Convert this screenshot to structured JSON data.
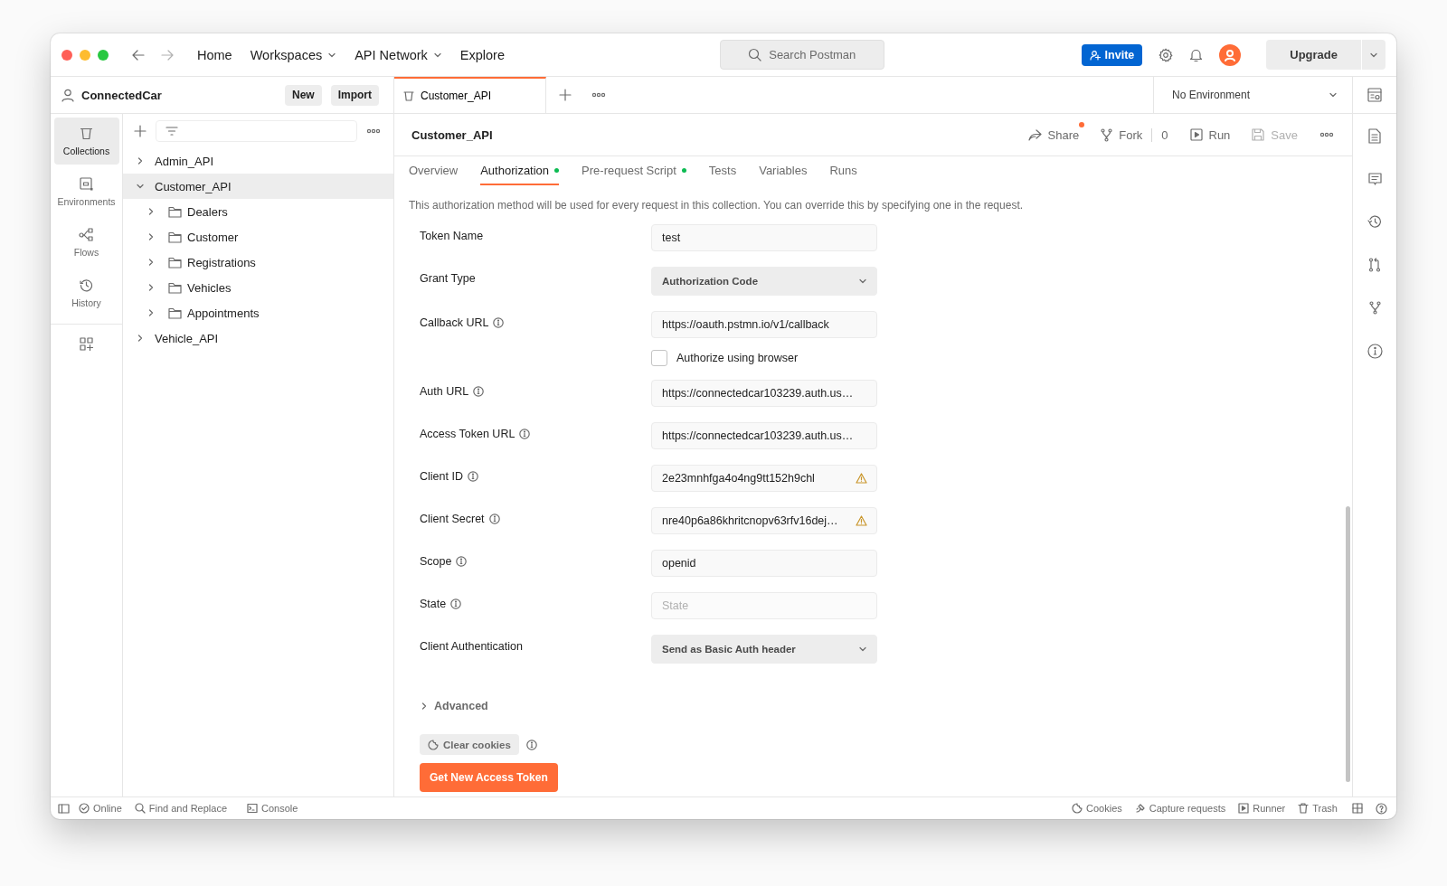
{
  "nav": [
    {
      "label": "Home",
      "has_menu": false
    },
    {
      "label": "Workspaces",
      "has_menu": true
    },
    {
      "label": "API Network",
      "has_menu": true
    },
    {
      "label": "Explore",
      "has_menu": false
    }
  ],
  "search": {
    "placeholder": "Search Postman"
  },
  "invite_button": "Invite",
  "upgrade_button": "Upgrade",
  "workspace": {
    "name": "ConnectedCar",
    "buttons": [
      "New",
      "Import"
    ]
  },
  "rail": [
    {
      "label": "Collections",
      "kind": "collections",
      "selected": true
    },
    {
      "label": "Environments",
      "kind": "environments",
      "selected": false
    },
    {
      "label": "Flows",
      "kind": "flows",
      "selected": false
    },
    {
      "label": "History",
      "kind": "history",
      "selected": false
    }
  ],
  "tree": [
    {
      "label": "Admin_API",
      "kind": "collection",
      "expanded": false,
      "selected": false
    },
    {
      "label": "Customer_API",
      "kind": "collection",
      "expanded": true,
      "selected": true,
      "children": [
        {
          "label": "Dealers",
          "kind": "folder",
          "expanded": false,
          "selected": false
        },
        {
          "label": "Customer",
          "kind": "folder",
          "expanded": false,
          "selected": false
        },
        {
          "label": "Registrations",
          "kind": "folder",
          "expanded": false,
          "selected": false
        },
        {
          "label": "Vehicles",
          "kind": "folder",
          "expanded": false,
          "selected": false
        },
        {
          "label": "Appointments",
          "kind": "folder",
          "expanded": false,
          "selected": false
        }
      ]
    },
    {
      "label": "Vehicle_API",
      "kind": "collection",
      "expanded": false,
      "selected": false
    }
  ],
  "open_tabs": [
    {
      "label": "Customer_API",
      "selected": true
    }
  ],
  "environment": {
    "value": "No Environment"
  },
  "editor": {
    "title": "Customer_API",
    "actions": [
      {
        "label": "Share",
        "kind": "share",
        "notify": true,
        "disabled": false
      },
      {
        "label": "Fork",
        "kind": "fork",
        "count": "0",
        "notify": false,
        "disabled": false
      },
      {
        "label": "Run",
        "kind": "run",
        "notify": false,
        "disabled": false
      },
      {
        "label": "Save",
        "kind": "save",
        "notify": false,
        "disabled": true
      }
    ],
    "tabs": [
      {
        "label": "Overview",
        "selected": false,
        "dot": false
      },
      {
        "label": "Authorization",
        "selected": true,
        "dot": true
      },
      {
        "label": "Pre-request Script",
        "selected": false,
        "dot": true
      },
      {
        "label": "Tests",
        "selected": false,
        "dot": false
      },
      {
        "label": "Variables",
        "selected": false,
        "dot": false
      },
      {
        "label": "Runs",
        "selected": false,
        "dot": false
      }
    ],
    "description": "This authorization method will be used for every request in this collection. You can override this by specifying one in the request.",
    "fields": [
      {
        "kind": "text",
        "label": "Token Name",
        "info": false,
        "value": "test",
        "warning": false
      },
      {
        "kind": "select",
        "label": "Grant Type",
        "info": false,
        "value": "Authorization Code"
      },
      {
        "kind": "text",
        "label": "Callback URL",
        "info": true,
        "value": "https://oauth.pstmn.io/v1/callback",
        "warning": false
      },
      {
        "kind": "checkbox",
        "label": "Authorize using browser",
        "checked": false
      },
      {
        "kind": "text",
        "label": "Auth URL",
        "info": true,
        "value": "https://connectedcar103239.auth.us…",
        "warning": false
      },
      {
        "kind": "text",
        "label": "Access Token URL",
        "info": true,
        "value": "https://connectedcar103239.auth.us…",
        "warning": false
      },
      {
        "kind": "text",
        "label": "Client ID",
        "info": true,
        "value": "2e23mnhfga4o4ng9tt152h9chl",
        "warning": true
      },
      {
        "kind": "text",
        "label": "Client Secret",
        "info": true,
        "value": "nre40p6a86khritcnopv63rfv16dej…",
        "warning": true
      },
      {
        "kind": "text",
        "label": "Scope",
        "info": true,
        "value": "openid",
        "warning": false
      },
      {
        "kind": "text",
        "label": "State",
        "info": true,
        "placeholder": "State",
        "warning": false
      },
      {
        "kind": "select",
        "label": "Client Authentication",
        "info": false,
        "value": "Send as Basic Auth header"
      }
    ],
    "advanced": {
      "label": "Advanced",
      "expanded": false
    },
    "clear_cookies_button": "Clear cookies",
    "get_token_button": "Get New Access Token"
  },
  "status_bar": {
    "left": [
      {
        "label": "Online",
        "kind": "online"
      },
      {
        "label": "Find and Replace",
        "kind": "find"
      },
      {
        "label": "Console",
        "kind": "console"
      }
    ],
    "right": [
      {
        "label": "Cookies",
        "kind": "cookies"
      },
      {
        "label": "Capture requests",
        "kind": "capture"
      },
      {
        "label": "Runner",
        "kind": "runner"
      },
      {
        "label": "Trash",
        "kind": "trash"
      }
    ]
  }
}
